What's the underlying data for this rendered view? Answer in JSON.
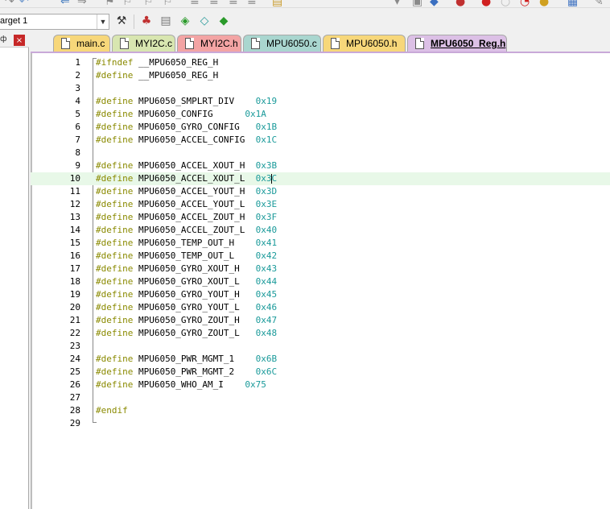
{
  "toolbar": {
    "target_value": "arget 1"
  },
  "left_panel": {
    "pin_glyph": "ф",
    "close_glyph": "×"
  },
  "tabs": [
    {
      "label": "main.c",
      "bg": "#f7d77a",
      "active": false
    },
    {
      "label": "MYI2C.c",
      "bg": "#d8e6b0",
      "active": false
    },
    {
      "label": "MYI2C.h",
      "bg": "#f3a4a4",
      "active": false
    },
    {
      "label": "MPU6050.c",
      "bg": "#a9d6cf",
      "active": false
    },
    {
      "label": "MPU6050.h",
      "bg": "#f7d77a",
      "active": false
    },
    {
      "label": "MPU6050_Reg.h",
      "bg": "#dcc0e6",
      "active": true
    }
  ],
  "colors": {
    "keyword": "#8a8a00",
    "hex_value": "#1a9a9a",
    "current_line": "#e8f8e8"
  },
  "editor": {
    "current_line": 10,
    "lines": [
      {
        "n": "1",
        "kw": "#ifndef",
        "id": "__MPU6050_REG_H",
        "val": ""
      },
      {
        "n": "2",
        "kw": "#define",
        "id": "__MPU6050_REG_H",
        "val": ""
      },
      {
        "n": "3",
        "kw": "",
        "id": "",
        "val": ""
      },
      {
        "n": "4",
        "kw": "#define",
        "id": "MPU6050_SMPLRT_DIV",
        "val": "0x19"
      },
      {
        "n": "5",
        "kw": "#define",
        "id": "MPU6050_CONFIG",
        "val": "0x1A"
      },
      {
        "n": "6",
        "kw": "#define",
        "id": "MPU6050_GYRO_CONFIG",
        "val": "0x1B"
      },
      {
        "n": "7",
        "kw": "#define",
        "id": "MPU6050_ACCEL_CONFIG",
        "val": "0x1C"
      },
      {
        "n": "8",
        "kw": "",
        "id": "",
        "val": ""
      },
      {
        "n": "9",
        "kw": "#define",
        "id": "MPU6050_ACCEL_XOUT_H",
        "val": "0x3B"
      },
      {
        "n": "10",
        "kw": "#define",
        "id": "MPU6050_ACCEL_XOUT_L",
        "val": "0x3C"
      },
      {
        "n": "11",
        "kw": "#define",
        "id": "MPU6050_ACCEL_YOUT_H",
        "val": "0x3D"
      },
      {
        "n": "12",
        "kw": "#define",
        "id": "MPU6050_ACCEL_YOUT_L",
        "val": "0x3E"
      },
      {
        "n": "13",
        "kw": "#define",
        "id": "MPU6050_ACCEL_ZOUT_H",
        "val": "0x3F"
      },
      {
        "n": "14",
        "kw": "#define",
        "id": "MPU6050_ACCEL_ZOUT_L",
        "val": "0x40"
      },
      {
        "n": "15",
        "kw": "#define",
        "id": "MPU6050_TEMP_OUT_H",
        "val": "0x41"
      },
      {
        "n": "16",
        "kw": "#define",
        "id": "MPU6050_TEMP_OUT_L",
        "val": "0x42"
      },
      {
        "n": "17",
        "kw": "#define",
        "id": "MPU6050_GYRO_XOUT_H",
        "val": "0x43"
      },
      {
        "n": "18",
        "kw": "#define",
        "id": "MPU6050_GYRO_XOUT_L",
        "val": "0x44"
      },
      {
        "n": "19",
        "kw": "#define",
        "id": "MPU6050_GYRO_YOUT_H",
        "val": "0x45"
      },
      {
        "n": "20",
        "kw": "#define",
        "id": "MPU6050_GYRO_YOUT_L",
        "val": "0x46"
      },
      {
        "n": "21",
        "kw": "#define",
        "id": "MPU6050_GYRO_ZOUT_H",
        "val": "0x47"
      },
      {
        "n": "22",
        "kw": "#define",
        "id": "MPU6050_GYRO_ZOUT_L",
        "val": "0x48"
      },
      {
        "n": "23",
        "kw": "",
        "id": "",
        "val": ""
      },
      {
        "n": "24",
        "kw": "#define",
        "id": "MPU6050_PWR_MGMT_1",
        "val": "0x6B"
      },
      {
        "n": "25",
        "kw": "#define",
        "id": "MPU6050_PWR_MGMT_2",
        "val": "0x6C"
      },
      {
        "n": "26",
        "kw": "#define",
        "id": "MPU6050_WHO_AM_I",
        "val": "0x75"
      },
      {
        "n": "27",
        "kw": "",
        "id": "",
        "val": ""
      },
      {
        "n": "28",
        "kw": "#endif",
        "id": "",
        "val": ""
      },
      {
        "n": "29",
        "kw": "",
        "id": "",
        "val": ""
      }
    ]
  }
}
